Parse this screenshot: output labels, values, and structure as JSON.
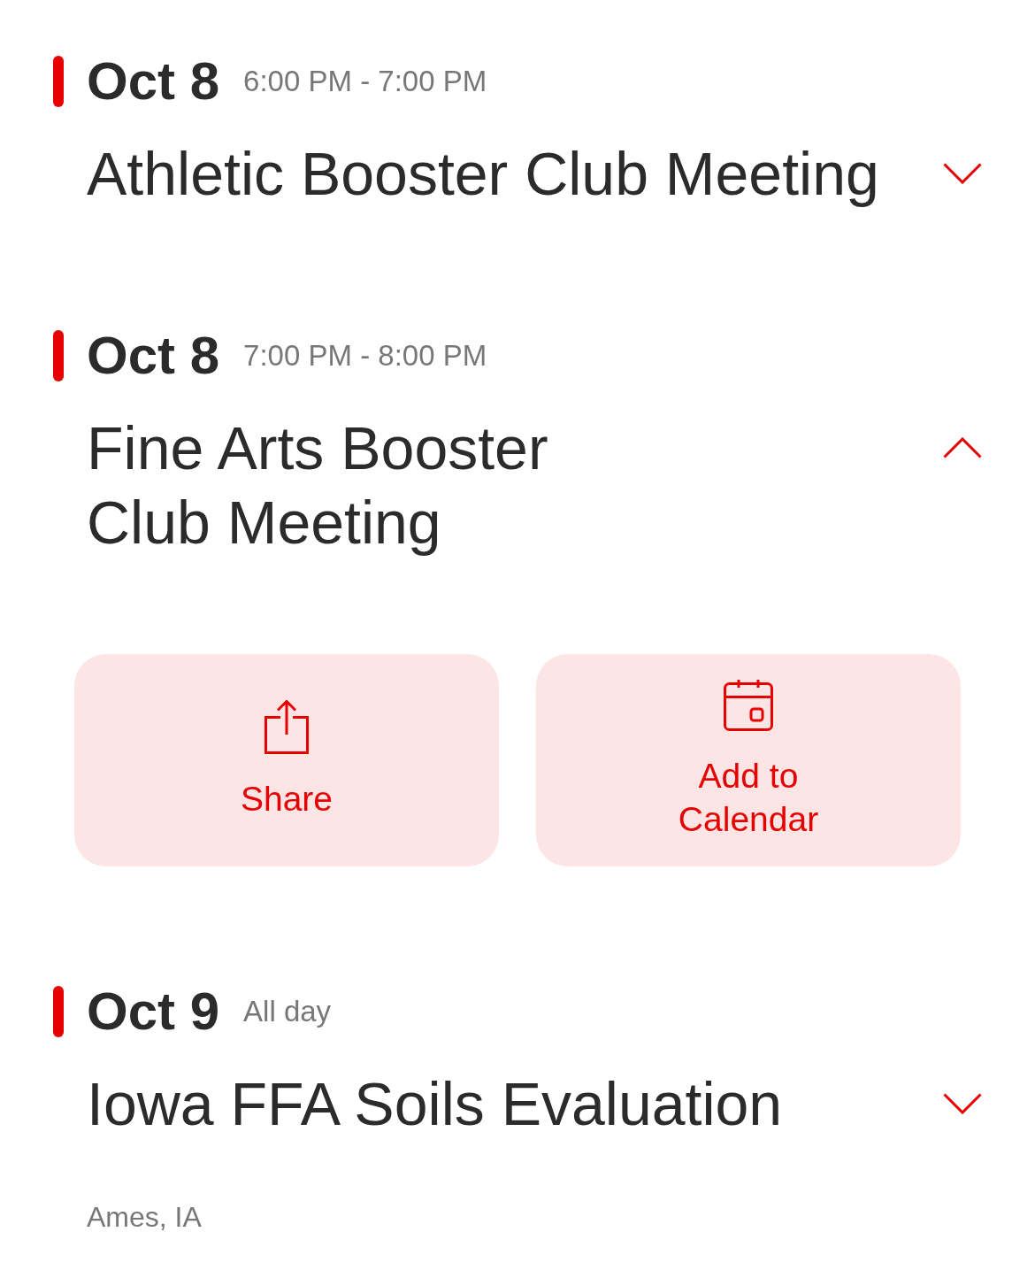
{
  "events": [
    {
      "date": "Oct 8",
      "time": "6:00 PM - 7:00 PM",
      "title": "Athletic Booster Club Meeting",
      "expanded": false
    },
    {
      "date": "Oct 8",
      "time": "7:00 PM - 8:00 PM",
      "title": "Fine Arts Booster Club Meeting",
      "expanded": true,
      "actions": [
        {
          "kind": "share",
          "label": "Share"
        },
        {
          "kind": "calendar",
          "label": "Add to Calendar"
        }
      ]
    },
    {
      "date": "Oct 9",
      "time": "All day",
      "title": "Iowa FFA Soils Evaluation",
      "expanded": false,
      "location": "Ames, IA"
    }
  ]
}
